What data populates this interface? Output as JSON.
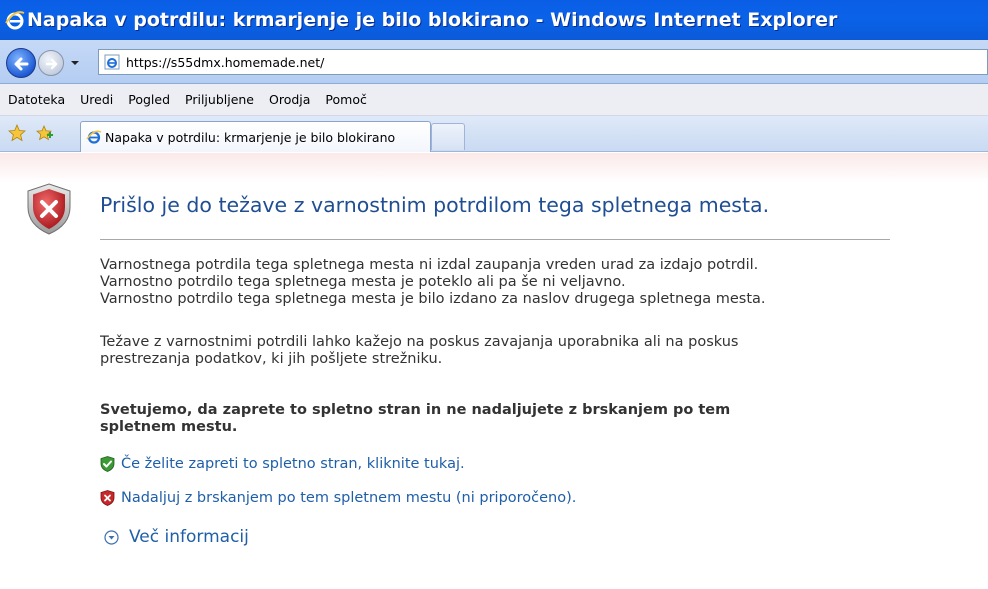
{
  "window": {
    "title": "Napaka v potrdilu: krmarjenje je bilo blokirano - Windows Internet Explorer"
  },
  "address": {
    "url": "https://s55dmx.homemade.net/"
  },
  "menu": {
    "items": [
      "Datoteka",
      "Uredi",
      "Pogled",
      "Priljubljene",
      "Orodja",
      "Pomoč"
    ]
  },
  "tabs": {
    "active_label": "Napaka v potrdilu: krmarjenje je bilo blokirano"
  },
  "content": {
    "heading": "Prišlo je do težave z varnostnim potrdilom tega spletnega mesta.",
    "paragraph1": [
      "Varnostnega potrdila tega spletnega mesta ni izdal zaupanja vreden urad za izdajo potrdil.",
      "Varnostno potrdilo tega spletnega mesta je poteklo ali pa še ni veljavno.",
      "Varnostno potrdilo tega spletnega mesta je bilo izdano za naslov drugega spletnega mesta."
    ],
    "paragraph2": [
      "Težave z varnostnimi potrdili lahko kažejo na poskus zavajanja uporabnika ali na poskus",
      "prestrezanja podatkov, ki jih pošljete strežniku."
    ],
    "recommendation": [
      "Svetujemo, da zaprete to spletno stran in ne nadaljujete z brskanjem po tem",
      "spletnem mestu."
    ],
    "close_link": "Če želite zapreti to spletno stran, kliknite tukaj.",
    "continue_link": "Nadaljuj z brskanjem po tem spletnem mestu (ni priporočeno).",
    "more_info": "Več informacij"
  },
  "colors": {
    "titlebar": "#0a5ee6",
    "heading": "#1f4e92",
    "link": "#1f5fa8",
    "shield_red": "#c8282a",
    "shield_green": "#3a9a35"
  }
}
